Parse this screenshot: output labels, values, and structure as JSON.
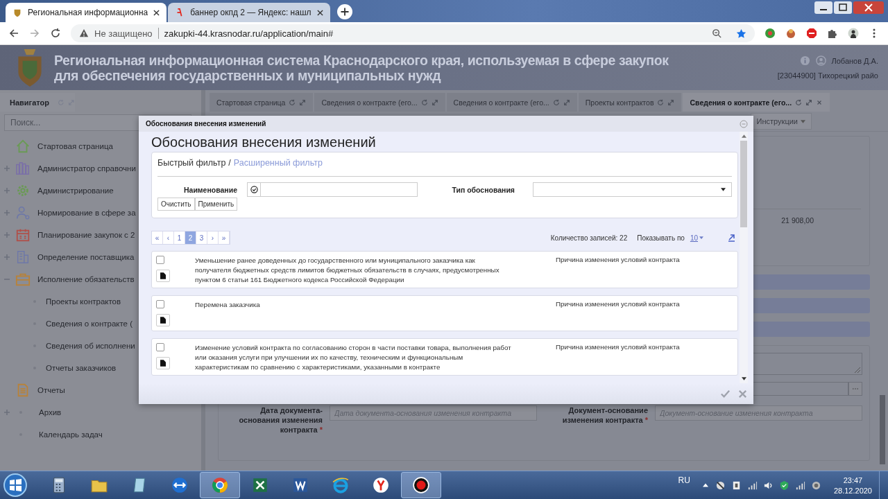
{
  "browser": {
    "tabs": [
      {
        "title": "Региональная информационна",
        "selected": true
      },
      {
        "title": "баннер окпд 2 — Яндекс: нашл",
        "selected": false
      }
    ],
    "address": {
      "security": "Не защищено",
      "url": "zakupki-44.krasnodar.ru/application/main#"
    }
  },
  "header": {
    "title_lines": [
      "Региональная информационная система Краснодарского края, используемая в сфере закупок",
      "для обеспечения государственных и муниципальных нужд"
    ],
    "user": "Лобанов Д.А.",
    "organization": "[23044900] Тихорецкий райо"
  },
  "navigator": {
    "title": "Навигатор",
    "search": {
      "placeholder": "Поиск..."
    },
    "items": [
      {
        "label": "Стартовая страница"
      },
      {
        "label": "Администратор справочни",
        "expanded": false
      },
      {
        "label": "Администрирование",
        "expanded": false
      },
      {
        "label": "Нормирование в сфере за",
        "expanded": false
      },
      {
        "label": "Планирование закупок с 2",
        "expanded": false
      },
      {
        "label": "Определение поставщика",
        "expanded": false
      },
      {
        "label": "Исполнение обязательств",
        "expanded": true,
        "children": [
          {
            "label": "Проекты контрактов"
          },
          {
            "label": "Сведения о контракте ("
          },
          {
            "label": "Сведения об исполнени"
          },
          {
            "label": "Отчеты заказчиков"
          }
        ]
      },
      {
        "label": "Отчеты"
      },
      {
        "label": "Архив",
        "expanded": false
      },
      {
        "label": "Календарь задач"
      }
    ]
  },
  "content_tabs": [
    {
      "label": "Стартовая страница",
      "selected": false
    },
    {
      "label": "Сведения о контракте (его...",
      "selected": false
    },
    {
      "label": "Сведения о контракте (его...",
      "selected": false
    },
    {
      "label": "Проекты контрактов",
      "selected": false
    },
    {
      "label": "Сведения о контракте (его...",
      "selected": true
    }
  ],
  "form": {
    "instructions": "Инструкции",
    "amount": "21 908,00",
    "fields": [
      {
        "label": "Дата документа-основания изменения контракта",
        "mark": "*",
        "placeholder": "Дата документа-основания изменения контракта"
      },
      {
        "label": "Документ-основание изменения контракта",
        "mark": "*",
        "placeholder": "Документ-основание изменения контракта"
      }
    ]
  },
  "dialog": {
    "window_title": "Обоснования внесения изменений",
    "heading": "Обоснования внесения изменений",
    "filter": {
      "quick": "Быстрый фильтр",
      "separator": "/",
      "advanced": "Расширенный фильтр",
      "name_label": "Наименование",
      "type_label": "Тип обоснования",
      "buttons": [
        "Очистить",
        "Применить"
      ]
    },
    "pager": [
      {
        "label": "«",
        "selected": false
      },
      {
        "label": "‹",
        "selected": false
      },
      {
        "label": "1",
        "selected": false
      },
      {
        "label": "2",
        "selected": true
      },
      {
        "label": "3",
        "selected": false
      },
      {
        "label": "›",
        "selected": false
      },
      {
        "label": "»",
        "selected": false
      }
    ],
    "record_count": "Количество записей: 22",
    "page_size_label": "Показывать по",
    "page_size": "10",
    "rows": [
      {
        "checked": false,
        "text": "Уменьшение ранее доведенных до государственного или муниципального заказчика как получателя бюджетных средств лимитов бюджетных обязательств в случаях, предусмотренных пунктом 6 статьи 161 Бюджетного кодекса Российской Федерации",
        "type": "Причина изменения условий контракта"
      },
      {
        "checked": false,
        "text": "Перемена заказчика",
        "type": "Причина изменения условий контракта"
      },
      {
        "checked": false,
        "text": "Изменение условий контракта по согласованию сторон в части поставки товара, выполнения работ или оказания услуги при улучшении их по качеству, техническим и функциональным характеристикам по сравнению с характеристиками, указанными в контракте",
        "type": "Причина изменения условий контракта"
      }
    ]
  },
  "taskbar": {
    "apps": [
      {
        "selected": false
      },
      {
        "selected": false
      },
      {
        "selected": false
      },
      {
        "selected": false
      },
      {
        "selected": true
      },
      {
        "selected": false
      },
      {
        "selected": false
      },
      {
        "selected": false
      },
      {
        "selected": false
      },
      {
        "selected": true
      }
    ],
    "language": "RU",
    "time": "23:47",
    "date": "28.12.2020"
  }
}
